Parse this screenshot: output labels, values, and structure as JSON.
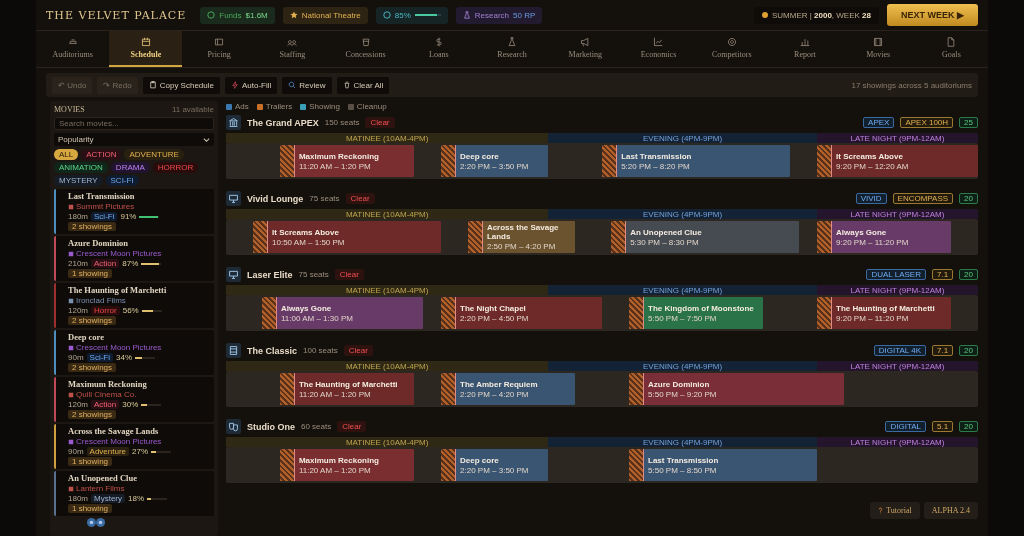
{
  "header": {
    "title": "THE VELVET PALACE",
    "stats": [
      {
        "kind": "funds",
        "label": "Funds",
        "value": "$1.6M"
      },
      {
        "kind": "rank",
        "label": "National Theatre"
      },
      {
        "kind": "rating",
        "label": "85%",
        "level": 0.85
      },
      {
        "kind": "research",
        "label": "Research",
        "value": "50 RP"
      }
    ],
    "season": "SUMMER | **2000**, WEEK **28**",
    "next_button": "NEXT WEEK ▶"
  },
  "nav": [
    {
      "label": "Auditoriums",
      "selected": false
    },
    {
      "label": "Schedule",
      "selected": true
    },
    {
      "label": "Pricing",
      "selected": false
    },
    {
      "label": "Staffing",
      "selected": false
    },
    {
      "label": "Concessions",
      "selected": false
    },
    {
      "label": "Loans",
      "selected": false
    },
    {
      "label": "Research",
      "selected": false
    },
    {
      "label": "Marketing",
      "selected": false
    },
    {
      "label": "Economics",
      "selected": false
    },
    {
      "label": "Competitors",
      "selected": false
    },
    {
      "label": "Report",
      "selected": false
    },
    {
      "label": "Movies",
      "selected": false
    },
    {
      "label": "Goals",
      "selected": false
    }
  ],
  "toolbar": {
    "buttons": [
      {
        "label": "↶ Undo",
        "kind": "plain",
        "disabled": true
      },
      {
        "label": "↷ Redo",
        "kind": "plain",
        "disabled": true
      },
      {
        "label": "Copy Schedule",
        "kind": "copy",
        "disabled": false
      },
      {
        "label": "Auto-Fill",
        "kind": "autofill",
        "disabled": false
      },
      {
        "label": "Review",
        "kind": "review",
        "disabled": false
      },
      {
        "label": "Clear All",
        "kind": "clear",
        "disabled": false
      }
    ],
    "summary": "17 showings across 5 auditoriums"
  },
  "sidebar": {
    "heading": "MOVIES",
    "count": "11 available",
    "search": {
      "placeholder": "Search movies..."
    },
    "sort": "Popularity",
    "genres": [
      {
        "label": "ALL",
        "kind": "all",
        "selected": true
      },
      {
        "label": "ACTION",
        "kind": "action",
        "selected": false
      },
      {
        "label": "ADVENTURE",
        "kind": "adventure",
        "selected": false
      },
      {
        "label": "ANIMATION",
        "kind": "animation",
        "selected": false
      },
      {
        "label": "DRAMA",
        "kind": "drama",
        "selected": false
      },
      {
        "label": "HORROR",
        "kind": "horror",
        "selected": false
      },
      {
        "label": "MYSTERY",
        "kind": "mystery",
        "selected": false
      },
      {
        "label": "SCI-FI",
        "kind": "scifi",
        "selected": false
      }
    ],
    "movies": [
      {
        "title": "Last Transmission",
        "studio": {
          "name": "Summit Pictures",
          "color": "#c0504a"
        },
        "runtime": "180m",
        "genre": {
          "label": "Sci-Fi",
          "kind": "scifi"
        },
        "popularity": "91%",
        "level": 0.91,
        "showings": "2 showings",
        "color": "#4f8fc0"
      },
      {
        "title": "Azure Dominion",
        "studio": {
          "name": "Crescent Moon Pictures",
          "color": "#9a5ad0"
        },
        "runtime": "210m",
        "genre": {
          "label": "Action",
          "kind": "action"
        },
        "popularity": "87%",
        "level": 0.87,
        "showings": "1 showing",
        "color": "#c04a5a"
      },
      {
        "title": "The Haunting of Marchetti",
        "studio": {
          "name": "Ironclad Films",
          "color": "#7a90b0"
        },
        "runtime": "120m",
        "genre": {
          "label": "Horror",
          "kind": "horror"
        },
        "popularity": "56%",
        "level": 0.56,
        "showings": "2 showings",
        "color": "#a03030"
      },
      {
        "title": "Deep core",
        "studio": {
          "name": "Crescent Moon Pictures",
          "color": "#9a5ad0"
        },
        "runtime": "90m",
        "genre": {
          "label": "Sci-Fi",
          "kind": "scifi"
        },
        "popularity": "34%",
        "level": 0.34,
        "showings": "2 showings",
        "color": "#4f8fc0"
      },
      {
        "title": "Maximum Reckoning",
        "studio": {
          "name": "Quill Cinema Co.",
          "color": "#c0504a"
        },
        "runtime": "120m",
        "genre": {
          "label": "Action",
          "kind": "action"
        },
        "popularity": "30%",
        "level": 0.3,
        "showings": "2 showings",
        "color": "#c04a5a"
      },
      {
        "title": "Across the Savage Lands",
        "studio": {
          "name": "Crescent Moon Pictures",
          "color": "#9a5ad0"
        },
        "runtime": "90m",
        "genre": {
          "label": "Adventure",
          "kind": "adventure"
        },
        "popularity": "27%",
        "level": 0.27,
        "showings": "1 showing",
        "color": "#d0a040"
      },
      {
        "title": "An Unopened Clue",
        "studio": {
          "name": "Lantern Films",
          "color": "#c0504a"
        },
        "runtime": "180m",
        "genre": {
          "label": "Mystery",
          "kind": "mystery"
        },
        "popularity": "18%",
        "level": 0.18,
        "showings": "1 showing",
        "color": "#5a7090"
      }
    ]
  },
  "legend": [
    {
      "label": "Ads",
      "color": "#3a78b0"
    },
    {
      "label": "Trailers",
      "color": "#c8702a"
    },
    {
      "label": "Showing",
      "color": "#3aa0b8"
    },
    {
      "label": "Cleanup",
      "color": "#5a5048"
    }
  ],
  "auditoriums": [
    {
      "name": "The Grand APEX",
      "seats": "150 seats",
      "clear": "Clear",
      "kind": "premium",
      "tags": [
        {
          "label": "APEX",
          "kind": "format"
        },
        {
          "label": "APEX 100H",
          "kind": "sound"
        },
        {
          "label": "25",
          "kind": "count"
        }
      ],
      "dayparts": [
        "MATINEE (10AM-4PM)",
        "EVENING (4PM-9PM)",
        "LATE NIGHT (9PM-12AM)"
      ],
      "showings": [
        {
          "title": "Maximum Reckoning",
          "time": "11:20 AM – 1:20 PM",
          "color": "#7a2e30"
        },
        {
          "title": "Deep core",
          "time": "2:20 PM – 3:50 PM",
          "color": "#3a5572"
        },
        {
          "title": "Last Transmission",
          "time": "5:20 PM – 8:20 PM",
          "color": "#3a5572"
        },
        {
          "title": "It Screams Above",
          "time": "9:20 PM – 12:20 AM",
          "color": "#6e2a28"
        }
      ]
    },
    {
      "name": "Vivid Lounge",
      "seats": "75 seats",
      "clear": "Clear",
      "kind": "screen",
      "tags": [
        {
          "label": "VIVID",
          "kind": "format"
        },
        {
          "label": "ENCOMPASS",
          "kind": "sound"
        },
        {
          "label": "20",
          "kind": "count"
        }
      ],
      "dayparts": [
        "MATINEE (10AM-4PM)",
        "EVENING (4PM-9PM)",
        "LATE NIGHT (9PM-12AM)"
      ],
      "showings": [
        {
          "title": "It Screams Above",
          "time": "10:50 AM – 1:50 PM",
          "color": "#6e2a28"
        },
        {
          "title": "Across the Savage Lands",
          "time": "2:50 PM – 4:20 PM",
          "color": "#6b5330"
        },
        {
          "title": "An Unopened Clue",
          "time": "5:30 PM – 8:30 PM",
          "color": "#464b52"
        },
        {
          "title": "Always Gone",
          "time": "9:20 PM – 11:20 PM",
          "color": "#683a68"
        }
      ]
    },
    {
      "name": "Laser Elite",
      "seats": "75 seats",
      "clear": "Clear",
      "kind": "screen",
      "tags": [
        {
          "label": "DUAL LASER",
          "kind": "format"
        },
        {
          "label": "7.1",
          "kind": "sound"
        },
        {
          "label": "20",
          "kind": "count"
        }
      ],
      "dayparts": [
        "MATINEE (10AM-4PM)",
        "EVENING (4PM-9PM)",
        "LATE NIGHT (9PM-12AM)"
      ],
      "showings": [
        {
          "title": "Always Gone",
          "time": "11:00 AM – 1:30 PM",
          "color": "#683a68"
        },
        {
          "title": "The Night Chapel",
          "time": "2:20 PM – 4:50 PM",
          "color": "#6e2a28"
        },
        {
          "title": "The Kingdom of Moonstone",
          "time": "5:50 PM – 7:50 PM",
          "color": "#2a7248"
        },
        {
          "title": "The Haunting of Marchetti",
          "time": "9:20 PM – 11:20 PM",
          "color": "#6e2a28"
        }
      ]
    },
    {
      "name": "The Classic",
      "seats": "100 seats",
      "clear": "Clear",
      "kind": "classic",
      "tags": [
        {
          "label": "DIGITAL 4K",
          "kind": "format"
        },
        {
          "label": "7.1",
          "kind": "sound"
        },
        {
          "label": "20",
          "kind": "count"
        }
      ],
      "dayparts": [
        "MATINEE (10AM-4PM)",
        "EVENING (4PM-9PM)",
        "LATE NIGHT (9PM-12AM)"
      ],
      "showings": [
        {
          "title": "The Haunting of Marchetti",
          "time": "11:20 AM – 1:20 PM",
          "color": "#6e2a28"
        },
        {
          "title": "The Amber Requiem",
          "time": "2:20 PM – 4:20 PM",
          "color": "#3a5572"
        },
        {
          "title": "Azure Dominion",
          "time": "5:50 PM – 9:20 PM",
          "color": "#7a2e38"
        }
      ]
    },
    {
      "name": "Studio One",
      "seats": "60 seats",
      "clear": "Clear",
      "kind": "studio",
      "tags": [
        {
          "label": "DIGITAL",
          "kind": "format"
        },
        {
          "label": "5.1",
          "kind": "sound"
        },
        {
          "label": "20",
          "kind": "count"
        }
      ],
      "dayparts": [
        "MATINEE (10AM-4PM)",
        "EVENING (4PM-9PM)",
        "LATE NIGHT (9PM-12AM)"
      ],
      "showings": [
        {
          "title": "Maximum Reckoning",
          "time": "11:20 AM – 1:20 PM",
          "color": "#7a2e30"
        },
        {
          "title": "Deep core",
          "time": "2:20 PM – 3:50 PM",
          "color": "#3a5572"
        },
        {
          "title": "Last Transmission",
          "time": "5:50 PM – 8:50 PM",
          "color": "#3a5572"
        }
      ]
    }
  ],
  "footer": [
    {
      "label": "Tutorial",
      "kind": "tutorial"
    },
    {
      "label": "ALPHA 2.4",
      "kind": "version"
    }
  ]
}
